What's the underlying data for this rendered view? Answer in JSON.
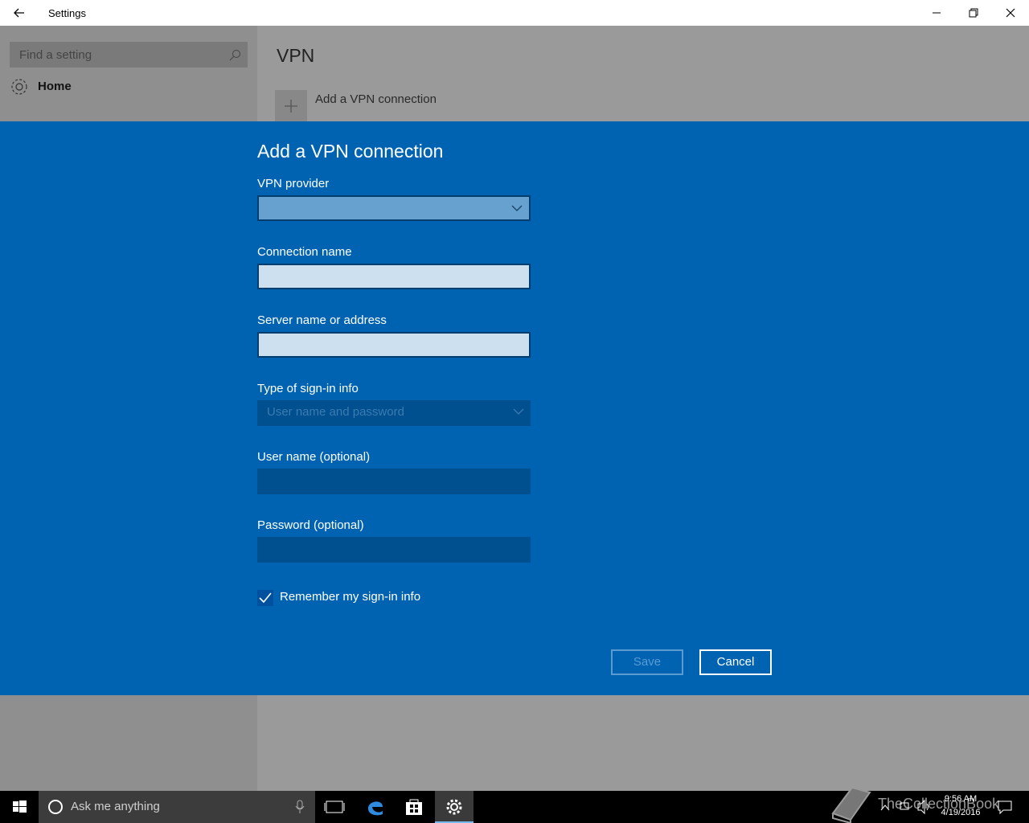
{
  "window": {
    "title": "Settings"
  },
  "sidebar": {
    "search_placeholder": "Find a setting",
    "home_label": "Home"
  },
  "page": {
    "heading": "VPN",
    "add_connection_label": "Add a VPN connection"
  },
  "dialog": {
    "title": "Add a VPN connection",
    "fields": {
      "vpn_provider": {
        "label": "VPN provider",
        "value": ""
      },
      "connection_name": {
        "label": "Connection name",
        "value": ""
      },
      "server": {
        "label": "Server name or address",
        "value": ""
      },
      "signin_type": {
        "label": "Type of sign-in info",
        "value": "User name and password"
      },
      "username": {
        "label": "User name (optional)",
        "value": ""
      },
      "password": {
        "label": "Password (optional)",
        "value": ""
      }
    },
    "remember": {
      "label": "Remember my sign-in info",
      "checked": true
    },
    "save_label": "Save",
    "cancel_label": "Cancel"
  },
  "taskbar": {
    "search_placeholder": "Ask me anything",
    "time": "9:56 AM",
    "date": "4/19/2016",
    "watermark": "TheCollectionBook"
  },
  "colors": {
    "dialog_bg": "#0063b1",
    "taskbar_bg": "#000000",
    "accent": "#76b9ed"
  }
}
